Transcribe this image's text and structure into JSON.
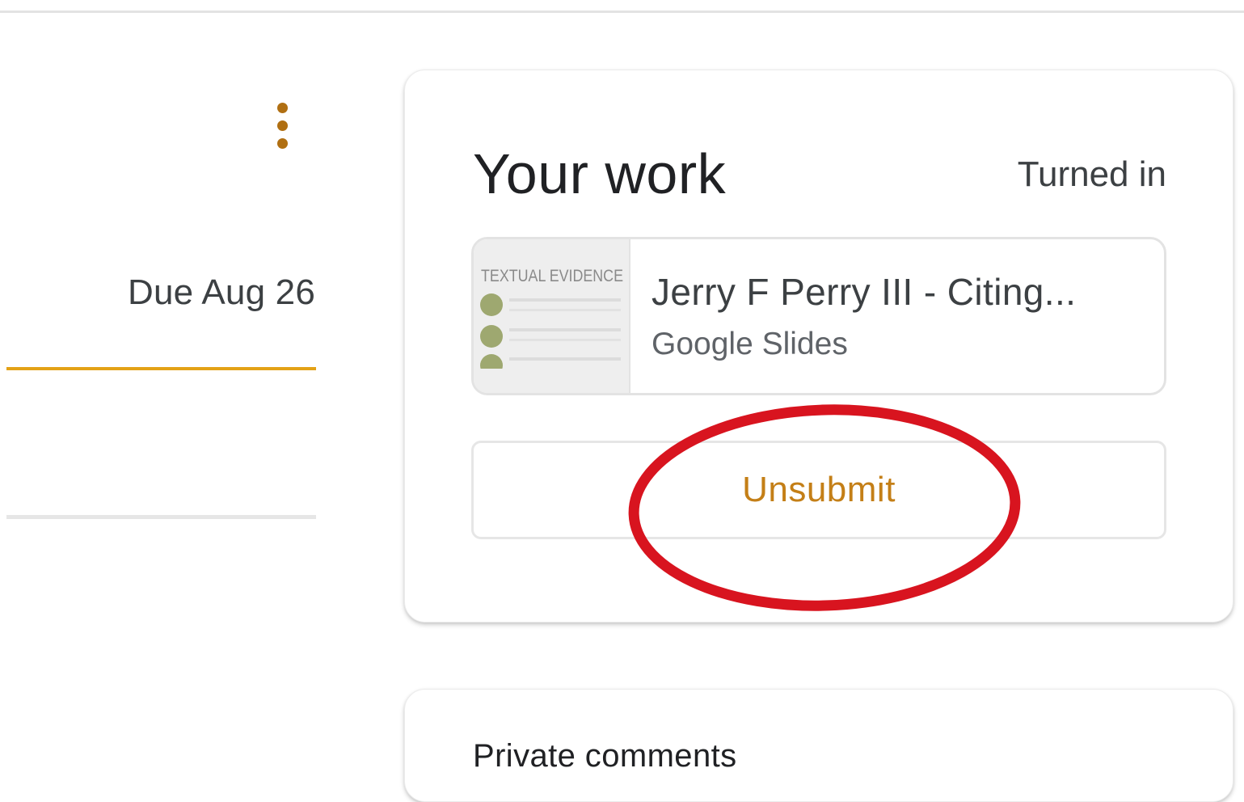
{
  "assignment": {
    "due_text": "Due Aug 26",
    "more_options_icon": "more-vert-icon"
  },
  "your_work": {
    "title": "Your work",
    "status": "Turned in",
    "attachment": {
      "title": "Jerry F Perry III - Citing...",
      "type": "Google Slides",
      "thumbnail_text": "TEXTUAL EVIDENCE"
    },
    "action_label": "Unsubmit"
  },
  "private_comments": {
    "title": "Private comments"
  },
  "colors": {
    "accent": "#e3a216",
    "action_text": "#c47f17",
    "annotation": "#d8141f"
  }
}
